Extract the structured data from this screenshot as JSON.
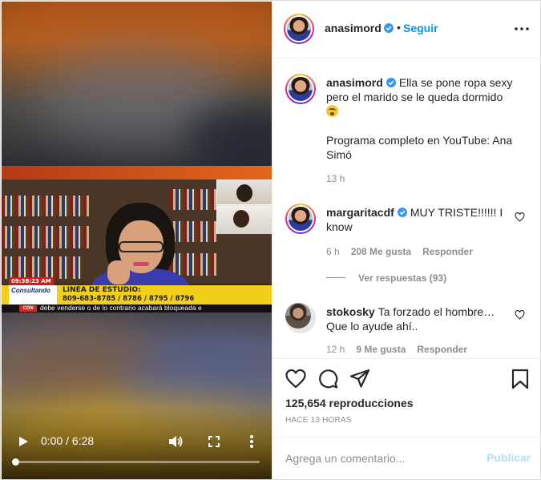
{
  "post": {
    "author": "anasimord",
    "follow_label": "Seguir",
    "separator": "•",
    "caption_line1": "Ella se pone ropa sexy pero el marido se le queda dormido",
    "caption_line2": "Programa completo en YouTube: Ana Simó",
    "caption_time": "13 h",
    "views": "125,654 reproducciones",
    "posted_ago": "HACE 13 HORAS"
  },
  "video": {
    "current_time": "0:00",
    "duration": "6:28",
    "time_display": "0:00 / 6:28",
    "progress": 0.0,
    "overlay": {
      "clock": "09:38:23 AM",
      "logo_text": "Consultando",
      "line_title": "LINEA DE ESTUDIO:",
      "line_phone": "809-683-8785 / 8786 / 8795 / 8796",
      "channel": "CDN",
      "ticker": "debe venderse o de lo contrario acabará bloqueada e"
    }
  },
  "comments": [
    {
      "user": "margaritacdf",
      "verified": true,
      "text": "MUY TRISTE!!!!!! I know",
      "time": "6 h",
      "likes": "208 Me gusta",
      "reply_label": "Responder",
      "view_replies": "Ver respuestas (93)"
    },
    {
      "user": "stokosky",
      "verified": false,
      "text": "Ta forzado el hombre… Que lo ayude ahí..",
      "time": "12 h",
      "likes": "9 Me gusta",
      "reply_label": "Responder"
    }
  ],
  "composer": {
    "placeholder": "Agrega un comentario...",
    "publish_label": "Publicar"
  },
  "icons": {
    "like": "heart-icon",
    "comment": "comment-icon",
    "share": "send-icon",
    "save": "bookmark-icon",
    "more": "more-options-icon",
    "verified": "verified-badge-icon"
  },
  "colors": {
    "link_blue": "#0095f6",
    "publish_disabled": "#b2dffc",
    "verified_blue": "#3897f0",
    "muted_text": "#8e8e8e"
  }
}
